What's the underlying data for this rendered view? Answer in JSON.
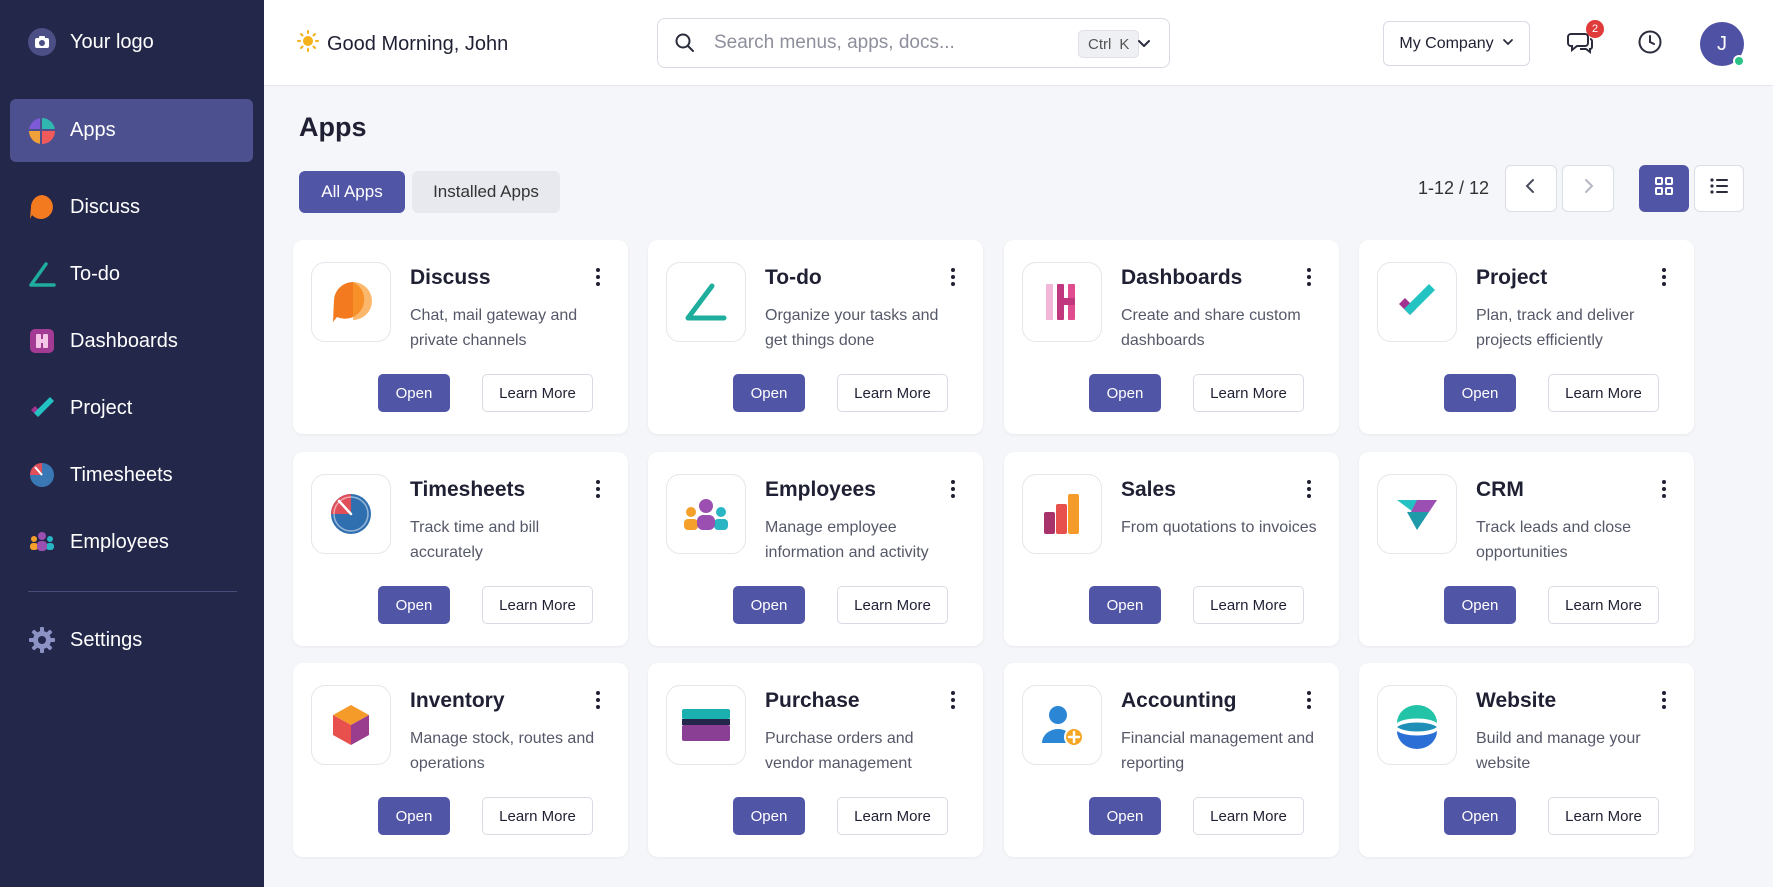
{
  "sidebar": {
    "logo_text": "Your logo",
    "items": [
      {
        "label": "Apps",
        "icon": "apps-icon"
      },
      {
        "label": "Discuss",
        "icon": "discuss-icon"
      },
      {
        "label": "To-do",
        "icon": "todo-icon"
      },
      {
        "label": "Dashboards",
        "icon": "dashboards-icon"
      },
      {
        "label": "Project",
        "icon": "project-icon"
      },
      {
        "label": "Timesheets",
        "icon": "timesheets-icon"
      },
      {
        "label": "Employees",
        "icon": "employees-icon"
      },
      {
        "label": "Settings",
        "icon": "gear-icon"
      }
    ]
  },
  "header": {
    "greeting": "Good Morning, John",
    "search_placeholder": "Search menus, apps, docs...",
    "shortcut_ctrl": "Ctrl",
    "shortcut_key": "K",
    "company": "My Company",
    "notification_count": "2",
    "avatar_initial": "J"
  },
  "main": {
    "title": "Apps",
    "filters": {
      "all": "All Apps",
      "installed": "Installed Apps"
    },
    "pager": "1-12 / 12",
    "open_label": "Open",
    "learn_label": "Learn More",
    "apps": [
      {
        "name": "Discuss",
        "desc": "Chat, mail gateway and private channels"
      },
      {
        "name": "To-do",
        "desc": "Organize your tasks and get things done"
      },
      {
        "name": "Dashboards",
        "desc": "Create and share custom dashboards"
      },
      {
        "name": "Project",
        "desc": "Plan, track and deliver projects efficiently"
      },
      {
        "name": "Timesheets",
        "desc": "Track time and bill accurately"
      },
      {
        "name": "Employees",
        "desc": "Manage employee information and activity"
      },
      {
        "name": "Sales",
        "desc": "From quotations to invoices"
      },
      {
        "name": "CRM",
        "desc": "Track leads and close opportunities"
      },
      {
        "name": "Inventory",
        "desc": "Manage stock, routes and operations"
      },
      {
        "name": "Purchase",
        "desc": "Purchase orders and vendor management"
      },
      {
        "name": "Accounting",
        "desc": "Financial management and reporting"
      },
      {
        "name": "Website",
        "desc": "Build and manage your website"
      }
    ]
  },
  "colors": {
    "sidebar_bg": "#23274a",
    "accent": "#5155a6",
    "badge": "#e03b3b",
    "online": "#2cc286"
  }
}
